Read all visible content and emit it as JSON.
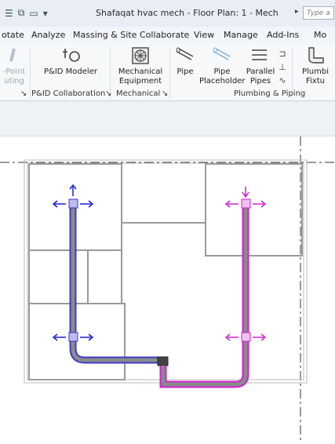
{
  "window": {
    "title": "Shafaqat hvac mech - Floor Plan: 1 - Mech",
    "search_placeholder": "Type a"
  },
  "tabs": [
    {
      "label": "otate"
    },
    {
      "label": "Analyze"
    },
    {
      "label": "Massing & Site"
    },
    {
      "label": "Collaborate"
    },
    {
      "label": "View"
    },
    {
      "label": "Manage"
    },
    {
      "label": "Add-Ins"
    },
    {
      "label": "Mo"
    }
  ],
  "ribbon": {
    "tools": {
      "point_routing": {
        "line1": "-Point",
        "line2": "uting"
      },
      "pid_modeler": {
        "line1": "P&ID Modeler"
      },
      "mechanical_equipment": {
        "line1": "Mechanical",
        "line2": "Equipment"
      },
      "pipe": {
        "line1": "Pipe"
      },
      "pipe_placeholder": {
        "line1": "Pipe",
        "line2": "Placeholder"
      },
      "parallel_pipes": {
        "line1": "Parallel",
        "line2": "Pipes"
      },
      "plumbing_fixture": {
        "line1": "Plumbi",
        "line2": "Fixtu"
      }
    },
    "groups": {
      "pid_collaboration": "P&ID Collaboration",
      "mechanical": "Mechanical",
      "plumbing_piping": "Plumbing & Piping",
      "launcher": "↘"
    }
  },
  "colors": {
    "supply_pipe": "#3c3cc8",
    "return_pipe": "#d020d0",
    "walls": "#9a9a9a",
    "pipe_fill": "#8a8a8a"
  }
}
